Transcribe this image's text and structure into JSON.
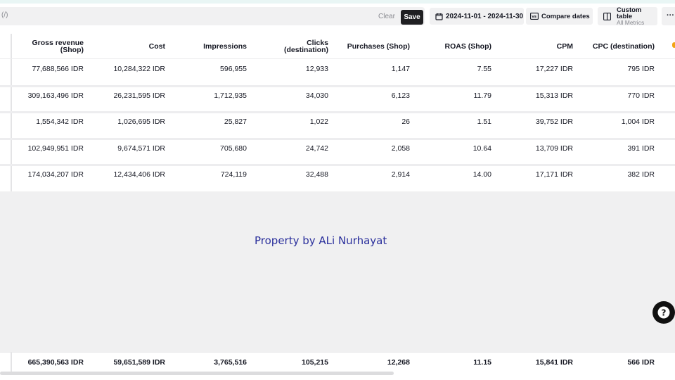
{
  "toolbar": {
    "filter_text": "(/)",
    "clear_label": "Clear",
    "save_label": "Save",
    "date_range": "2024-11-01 - 2024-11-30",
    "compare_label": "Compare dates",
    "custom_table_title": "Custom table",
    "custom_table_sub": "All Metrics",
    "more_label": "···"
  },
  "table": {
    "headers": [
      {
        "line1": "Gross revenue",
        "line2": "(Shop)"
      },
      {
        "line1": "Cost",
        "line2": ""
      },
      {
        "line1": "Impressions",
        "line2": ""
      },
      {
        "line1": "Clicks",
        "line2": "(destination)"
      },
      {
        "line1": "Purchases (Shop)",
        "line2": ""
      },
      {
        "line1": "ROAS (Shop)",
        "line2": ""
      },
      {
        "line1": "CPM",
        "line2": ""
      },
      {
        "line1": "CPC (destination)",
        "line2": ""
      }
    ],
    "rows": [
      [
        "77,688,566 IDR",
        "10,284,322 IDR",
        "596,955",
        "12,933",
        "1,147",
        "7.55",
        "17,227 IDR",
        "795 IDR"
      ],
      [
        "309,163,496 IDR",
        "26,231,595 IDR",
        "1,712,935",
        "34,030",
        "6,123",
        "11.79",
        "15,313 IDR",
        "770 IDR"
      ],
      [
        "1,554,342 IDR",
        "1,026,695 IDR",
        "25,827",
        "1,022",
        "26",
        "1.51",
        "39,752 IDR",
        "1,004 IDR"
      ],
      [
        "102,949,951 IDR",
        "9,674,571 IDR",
        "705,680",
        "24,742",
        "2,058",
        "10.64",
        "13,709 IDR",
        "391 IDR"
      ],
      [
        "174,034,207 IDR",
        "12,434,406 IDR",
        "724,119",
        "32,488",
        "2,914",
        "14.00",
        "17,171 IDR",
        "382 IDR"
      ]
    ],
    "totals": [
      "665,390,563 IDR",
      "59,651,589 IDR",
      "3,765,516",
      "105,215",
      "12,268",
      "11.15",
      "15,841 IDR",
      "566 IDR"
    ]
  },
  "watermark": "Property by ALi Nurhayat",
  "icons": {
    "calendar": "calendar-icon",
    "compare": "compare-icon",
    "columns": "columns-icon",
    "help": "help-icon"
  }
}
